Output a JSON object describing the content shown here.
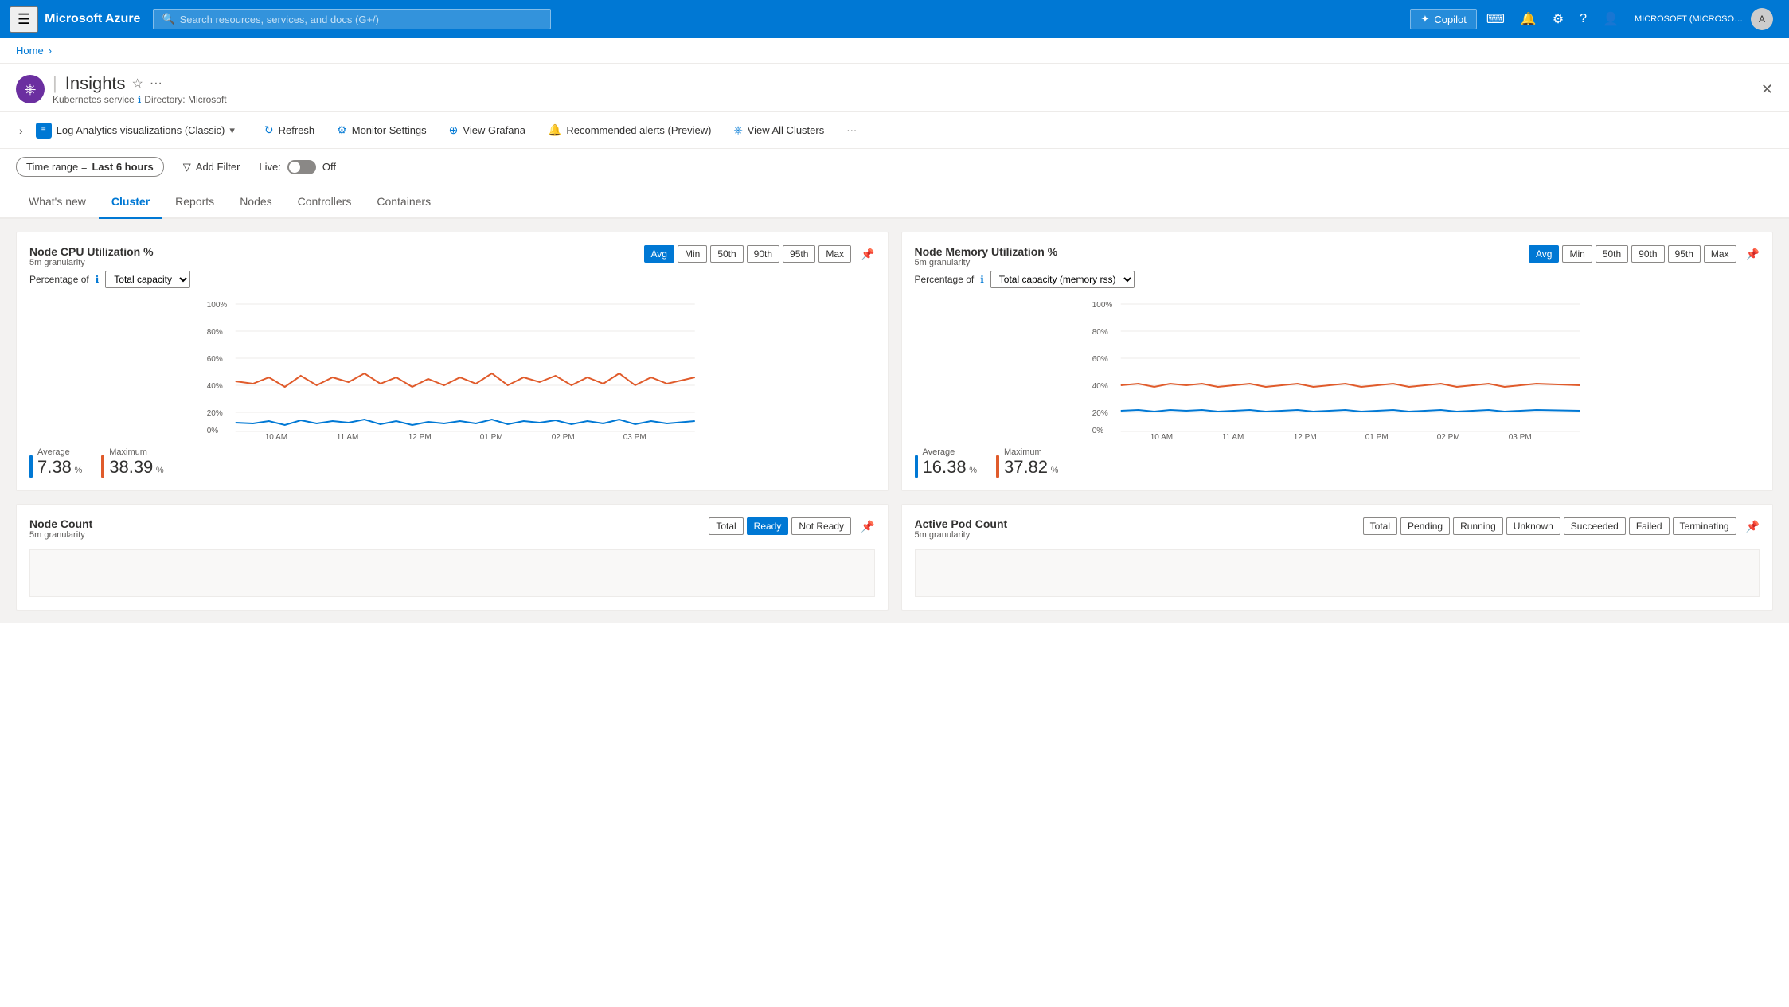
{
  "nav": {
    "hamburger": "☰",
    "logo": "Microsoft Azure",
    "search_placeholder": "Search resources, services, and docs (G+/)",
    "copilot_label": "Copilot",
    "account": "MICROSOFT (MICROSOFT.ONMI...",
    "icons": {
      "terminal": "⌨",
      "bell": "🔔",
      "gear": "⚙",
      "help": "?",
      "feedback": "👤"
    }
  },
  "breadcrumb": {
    "home": "Home",
    "sep": "›"
  },
  "page": {
    "icon": "⎈",
    "title": "Insights",
    "service": "Kubernetes service",
    "directory_label": "Directory: Microsoft"
  },
  "toolbar": {
    "service_dropdown": "Log Analytics visualizations (Classic)",
    "refresh": "Refresh",
    "monitor_settings": "Monitor Settings",
    "view_grafana": "View Grafana",
    "recommended_alerts": "Recommended alerts (Preview)",
    "view_all_clusters": "View All Clusters",
    "more": "..."
  },
  "filter_bar": {
    "time_range_prefix": "Time range =",
    "time_range_value": "Last 6 hours",
    "add_filter": "Add Filter",
    "live_label": "Live:",
    "live_state": "Off"
  },
  "tabs": [
    {
      "id": "whats-new",
      "label": "What's new",
      "active": false
    },
    {
      "id": "cluster",
      "label": "Cluster",
      "active": true
    },
    {
      "id": "reports",
      "label": "Reports",
      "active": false
    },
    {
      "id": "nodes",
      "label": "Nodes",
      "active": false
    },
    {
      "id": "controllers",
      "label": "Controllers",
      "active": false
    },
    {
      "id": "containers",
      "label": "Containers",
      "active": false
    }
  ],
  "cpu_chart": {
    "title": "Node CPU Utilization %",
    "granularity": "5m granularity",
    "buttons": [
      "Avg",
      "Min",
      "50th",
      "90th",
      "95th",
      "Max"
    ],
    "active_button": "Avg",
    "percentage_label": "Percentage of",
    "dropdown_value": "Total capacity",
    "y_labels": [
      "100%",
      "80%",
      "60%",
      "40%",
      "20%",
      "0%"
    ],
    "x_labels": [
      "10 AM",
      "11 AM",
      "12 PM",
      "01 PM",
      "02 PM",
      "03 PM"
    ],
    "avg_label": "Average",
    "avg_value": "7.38",
    "avg_unit": "%",
    "max_label": "Maximum",
    "max_value": "38.39",
    "max_unit": "%",
    "avg_color": "#0078d4",
    "max_color": "#e05b2b"
  },
  "memory_chart": {
    "title": "Node Memory Utilization %",
    "granularity": "5m granularity",
    "buttons": [
      "Avg",
      "Min",
      "50th",
      "90th",
      "95th",
      "Max"
    ],
    "active_button": "Avg",
    "percentage_label": "Percentage of",
    "dropdown_value": "Total capacity (memory rss)",
    "y_labels": [
      "100%",
      "80%",
      "60%",
      "40%",
      "20%",
      "0%"
    ],
    "x_labels": [
      "10 AM",
      "11 AM",
      "12 PM",
      "01 PM",
      "02 PM",
      "03 PM"
    ],
    "avg_label": "Average",
    "avg_value": "16.38",
    "avg_unit": "%",
    "max_label": "Maximum",
    "max_value": "37.82",
    "max_unit": "%",
    "avg_color": "#0078d4",
    "max_color": "#e05b2b"
  },
  "node_count": {
    "title": "Node Count",
    "granularity": "5m granularity",
    "buttons": [
      "Total",
      "Ready",
      "Not Ready"
    ]
  },
  "active_pod": {
    "title": "Active Pod Count",
    "granularity": "5m granularity",
    "buttons": [
      "Total",
      "Pending",
      "Running",
      "Unknown",
      "Succeeded",
      "Failed",
      "Terminating"
    ]
  }
}
